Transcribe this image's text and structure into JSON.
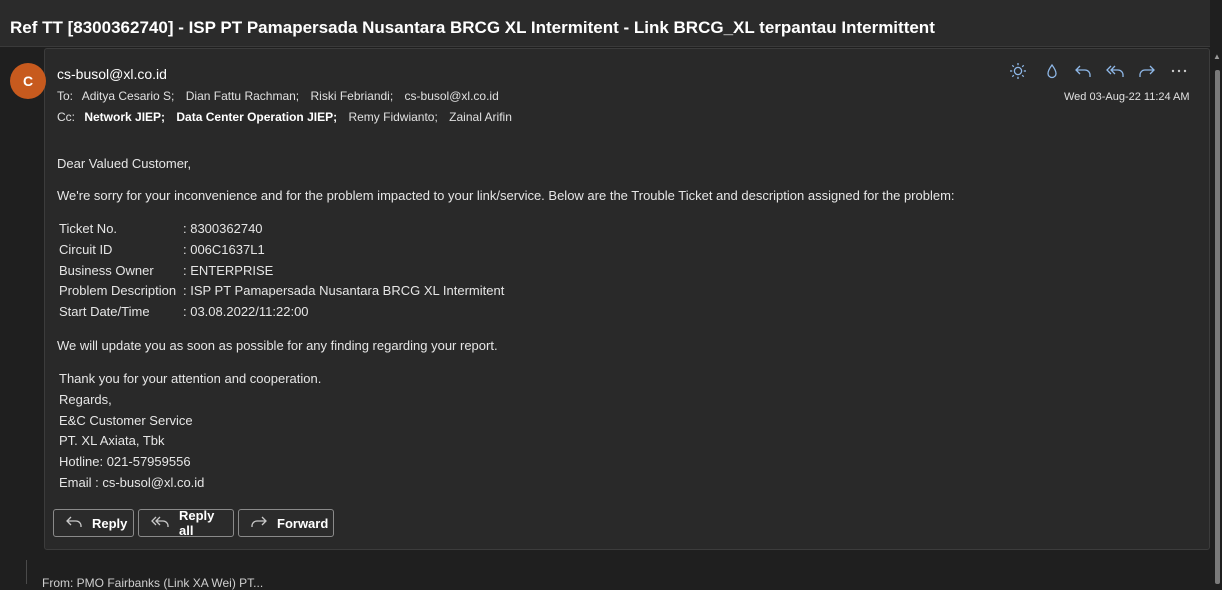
{
  "subject": "Ref TT [8300362740] - ISP PT Pamapersada Nusantara BRCG XL Intermitent - Link BRCG_XL terpantau Intermittent",
  "sender": {
    "initial": "C",
    "email": "cs-busol@xl.co.id",
    "avatar_color": "#c75a1e"
  },
  "to": {
    "label": "To:",
    "names": [
      "Aditya Cesario S;",
      "Dian Fattu Rachman;",
      "Riski Febriandi;",
      "cs-busol@xl.co.id"
    ]
  },
  "cc": {
    "label": "Cc:",
    "names_bold": [
      "Network JIEP;",
      "Data Center Operation JIEP;"
    ],
    "names": [
      "Remy Fidwianto;",
      "Zainal Arifin"
    ]
  },
  "date": "Wed 03-Aug-22 11:24 AM",
  "toolbar_icons": [
    "sun-icon",
    "like-icon",
    "reply-icon",
    "reply-all-icon",
    "forward-icon",
    "more-icon"
  ],
  "body": {
    "greeting": "Dear Valued Customer,",
    "intro": "We're sorry for your inconvenience and for the problem impacted to your link/service. Below are the Trouble Ticket and description assigned for the problem:",
    "ticket": [
      {
        "key": "Ticket No.",
        "value": ": 8300362740"
      },
      {
        "key": "Circuit ID",
        "value": ": 006C1637L1"
      },
      {
        "key": "Business Owner",
        "value": ": ENTERPRISE"
      },
      {
        "key": "Problem Description",
        "value": ": ISP PT Pamapersada Nusantara BRCG XL Intermitent"
      },
      {
        "key": "Start Date/Time",
        "value": ": 03.08.2022/11:22:00"
      }
    ],
    "update": "We will update you as soon as possible for any finding regarding your report.",
    "signature": [
      "Thank you for your attention and cooperation.",
      "Regards,",
      "E&C Customer Service",
      "PT. XL Axiata, Tbk",
      "Hotline: 021-57959556",
      "Email : cs-busol@xl.co.id"
    ]
  },
  "actions": {
    "reply": "Reply",
    "reply_all": "Reply all",
    "forward": "Forward"
  },
  "next_message_preview": "From: PMO Fairbanks (Link XA Wei) PT..."
}
